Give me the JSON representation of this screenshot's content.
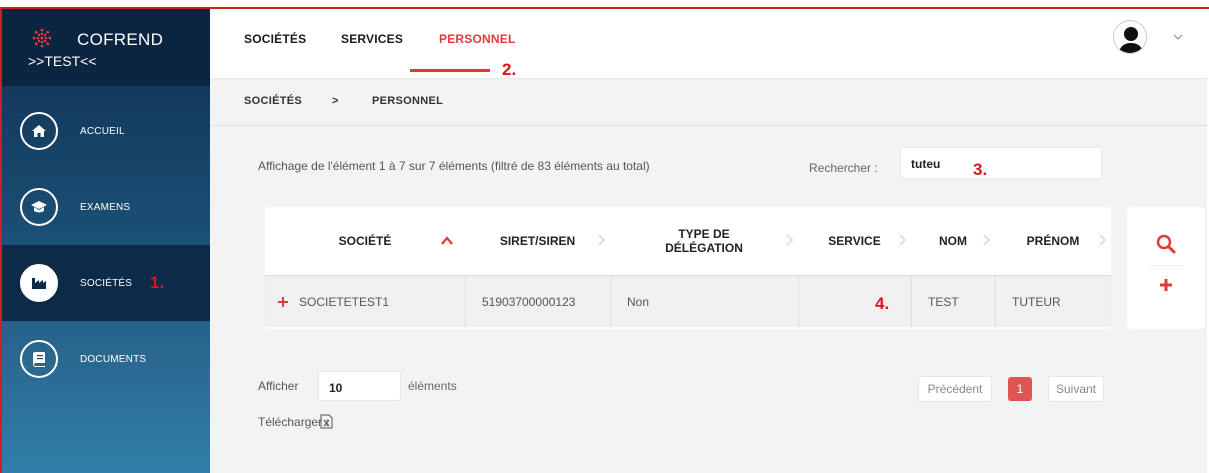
{
  "brand": {
    "name": "COFREND",
    "subtitle": ">>TEST<<"
  },
  "sidebar": {
    "items": [
      {
        "label": "ACCUEIL",
        "icon": "home-icon",
        "active": false
      },
      {
        "label": "EXAMENS",
        "icon": "graduation-cap-icon",
        "active": false
      },
      {
        "label": "SOCIÉTÉS",
        "icon": "factory-icon",
        "active": true
      },
      {
        "label": "DOCUMENTS",
        "icon": "book-icon",
        "active": false
      }
    ]
  },
  "topnav": {
    "tabs": [
      {
        "label": "SOCIÉTÉS",
        "active": false
      },
      {
        "label": "SERVICES",
        "active": false
      },
      {
        "label": "PERSONNEL",
        "active": true
      }
    ]
  },
  "annotations": {
    "a1": "1.",
    "a2": "2.",
    "a3": "3.",
    "a4": "4."
  },
  "breadcrumb": {
    "parent": "SOCIÉTÉS",
    "separator": ">",
    "current": "PERSONNEL"
  },
  "table_info": "Affichage de l'élément 1 à 7 sur 7 éléments (filtré de 83 éléments au total)",
  "search": {
    "label": "Rechercher :",
    "value": "tuteu"
  },
  "table": {
    "headers": [
      "SOCIÉTÉ",
      "SIRET/SIREN",
      "TYPE DE DÉLÉGATION",
      "SERVICE",
      "NOM",
      "PRÉNOM"
    ],
    "headers_lines": {
      "type_l1": "TYPE DE",
      "type_l2": "DÉLÉGATION"
    },
    "rows": [
      {
        "societe": "SOCIETETEST1",
        "siret": "51903700000123",
        "delegation": "Non",
        "service": "",
        "nom": "TEST",
        "prenom": "TUTEUR"
      }
    ]
  },
  "pagination": {
    "show_label": "Afficher",
    "page_size": "10",
    "show_suffix": "éléments",
    "download_label": "Télécharger :",
    "prev": "Précédent",
    "current_page": "1",
    "next": "Suivant"
  },
  "colors": {
    "accent": "#e23a3a",
    "sidebar_dark": "#0b2540",
    "annotation": "#e0131a"
  }
}
